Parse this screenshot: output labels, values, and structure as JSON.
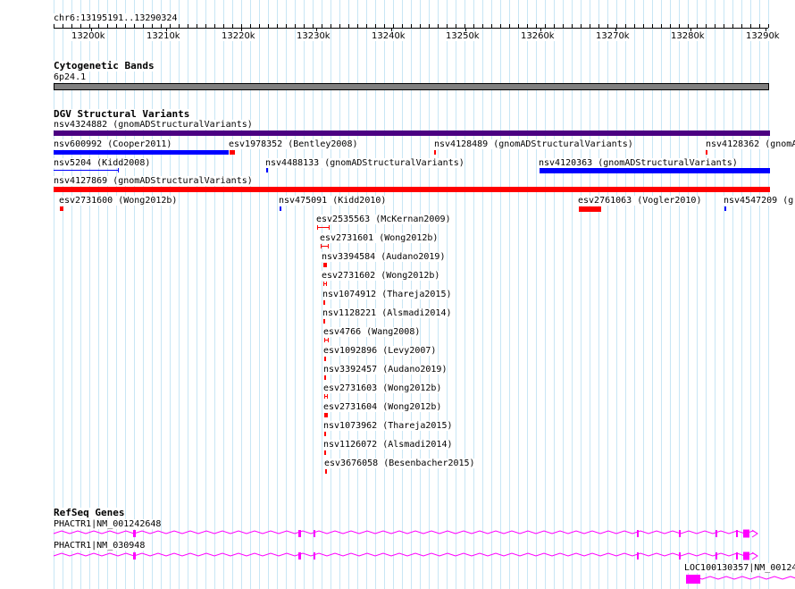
{
  "position_label": "chr6:13195191..13290324",
  "ruler_ticks": [
    "13200k",
    "13210k",
    "13220k",
    "13230k",
    "13240k",
    "13250k",
    "13260k",
    "13270k",
    "13280k",
    "13290k"
  ],
  "cytoband": {
    "title": "Cytogenetic Bands",
    "band_label": "6p24.1",
    "band_color": "#808080"
  },
  "dgv": {
    "title": "DGV Structural Variants",
    "colors": {
      "gain": "#0000ff",
      "loss": "#ff0000",
      "complex": "#4b0082"
    },
    "features": [
      {
        "label": "nsv4324882 (gnomADStructuralVariants)",
        "type": "complex"
      },
      {
        "label": "nsv600992 (Cooper2011)",
        "type": "gain"
      },
      {
        "label": "esv1978352 (Bentley2008)",
        "type": "loss"
      },
      {
        "label": "nsv4128489 (gnomADStructuralVariants)",
        "type": "loss"
      },
      {
        "label": "nsv4128362 (gnomA",
        "type": "loss"
      },
      {
        "label": "nsv5204 (Kidd2008)",
        "type": "gain"
      },
      {
        "label": "nsv4488133 (gnomADStructuralVariants)",
        "type": "gain"
      },
      {
        "label": "nsv4120363 (gnomADStructuralVariants)",
        "type": "gain"
      },
      {
        "label": "nsv4127869 (gnomADStructuralVariants)",
        "type": "loss"
      },
      {
        "label": "esv2731600 (Wong2012b)",
        "type": "loss"
      },
      {
        "label": "nsv475091 (Kidd2010)",
        "type": "gain"
      },
      {
        "label": "esv2761063 (Vogler2010)",
        "type": "loss"
      },
      {
        "label": "nsv4547209 (g",
        "type": "gain"
      },
      {
        "label": "esv2535563 (McKernan2009)",
        "type": "loss"
      },
      {
        "label": "esv2731601 (Wong2012b)",
        "type": "loss"
      },
      {
        "label": "nsv3394584 (Audano2019)",
        "type": "loss"
      },
      {
        "label": "esv2731602 (Wong2012b)",
        "type": "loss"
      },
      {
        "label": "nsv1074912 (Thareja2015)",
        "type": "loss"
      },
      {
        "label": "nsv1128221 (Alsmadi2014)",
        "type": "loss"
      },
      {
        "label": "esv4766 (Wang2008)",
        "type": "loss"
      },
      {
        "label": "esv1092896 (Levy2007)",
        "type": "loss"
      },
      {
        "label": "nsv3392457 (Audano2019)",
        "type": "loss"
      },
      {
        "label": "esv2731603 (Wong2012b)",
        "type": "loss"
      },
      {
        "label": "esv2731604 (Wong2012b)",
        "type": "loss"
      },
      {
        "label": "nsv1073962 (Thareja2015)",
        "type": "loss"
      },
      {
        "label": "nsv1126072 (Alsmadi2014)",
        "type": "loss"
      },
      {
        "label": "esv3676058 (Besenbacher2015)",
        "type": "loss"
      }
    ]
  },
  "refseq": {
    "title": "RefSeq Genes",
    "color": "#ff00ff",
    "genes": [
      {
        "label": "PHACTR1|NM_001242648"
      },
      {
        "label": "PHACTR1|NM_030948"
      },
      {
        "label": "LOC100130357|NM_00124"
      }
    ]
  }
}
